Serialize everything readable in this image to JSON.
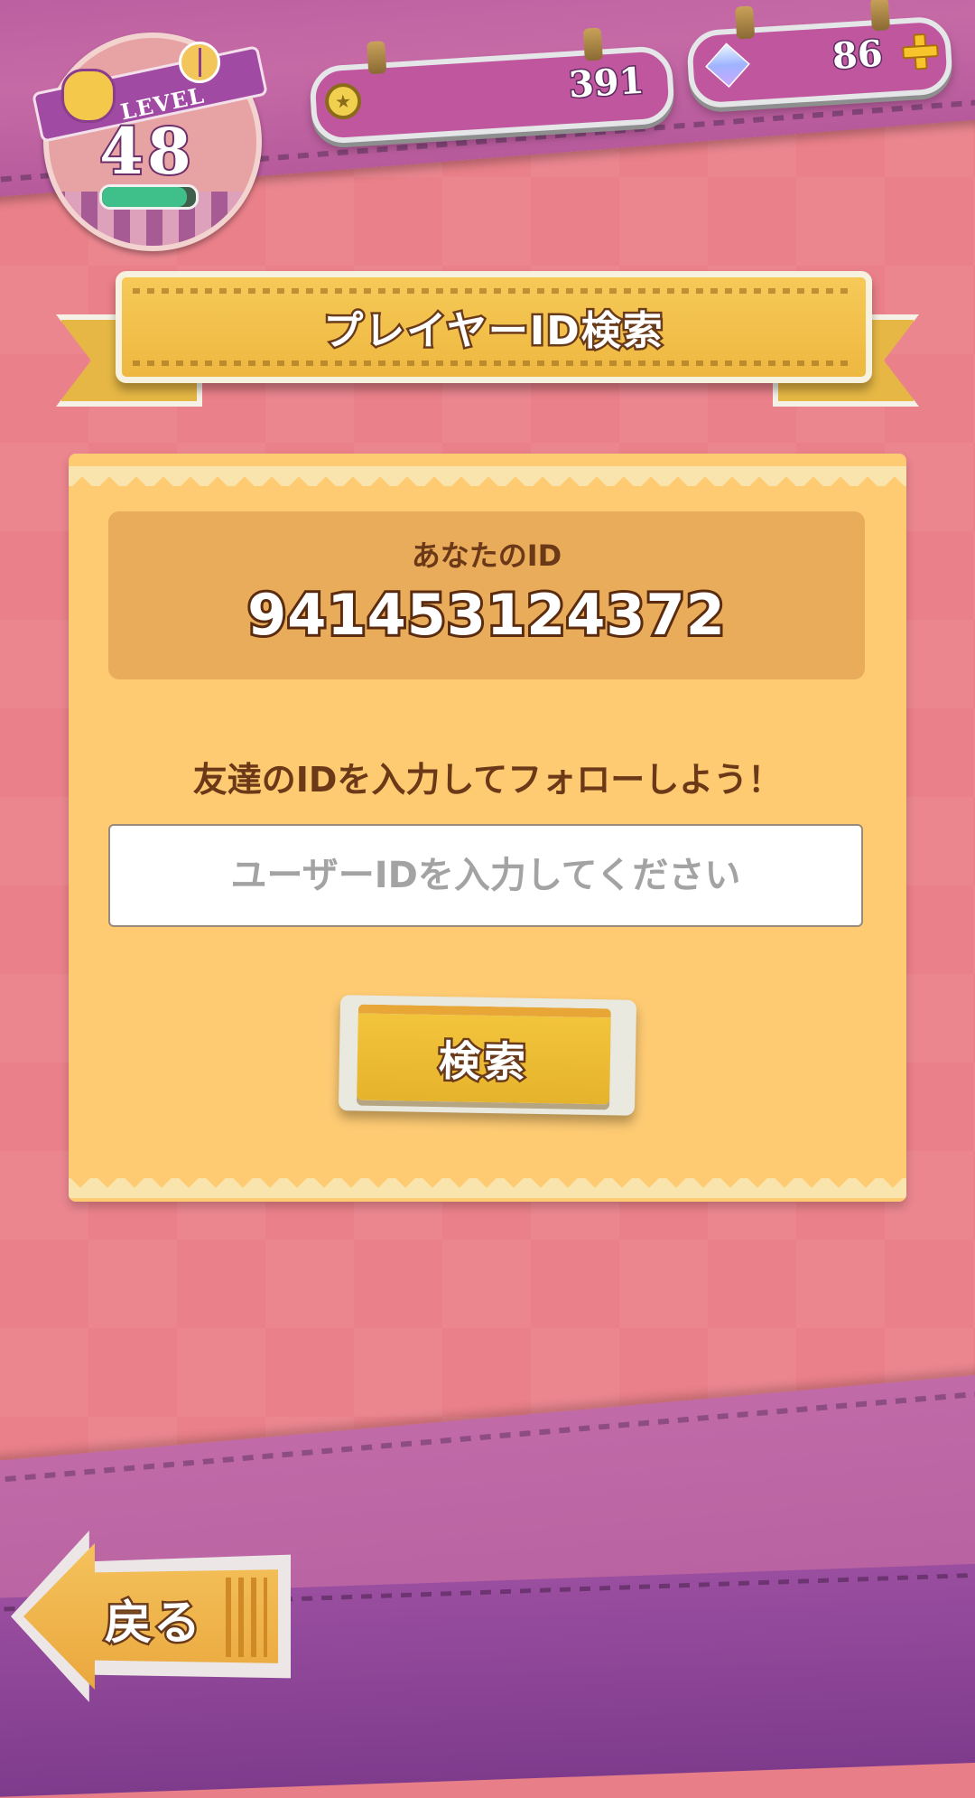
{
  "header": {
    "level_label": "LEVEL",
    "level_value": "48",
    "level_progress": 0.9,
    "coins": "391",
    "gems": "86"
  },
  "title": "プレイヤーID検索",
  "panel": {
    "your_id_label": "あなたのID",
    "your_id_value": "941453124372",
    "prompt": "友達のIDを入力してフォローしよう！",
    "input_placeholder": "ユーザーIDを入力してください",
    "input_value": "",
    "search_button": "検索"
  },
  "footer": {
    "back_button": "戻る"
  },
  "icons": {
    "coin": "coin-icon",
    "gem": "gem-icon",
    "plus": "plus-icon",
    "hand": "hand-icon",
    "peace": "peace-icon"
  },
  "colors": {
    "background": "#ea8089",
    "panel": "#fecb73",
    "id_box": "#e8ac5a",
    "ribbon": "#f6c957",
    "purple_strip": "#b85b9f",
    "text_brown": "#6b3818"
  }
}
